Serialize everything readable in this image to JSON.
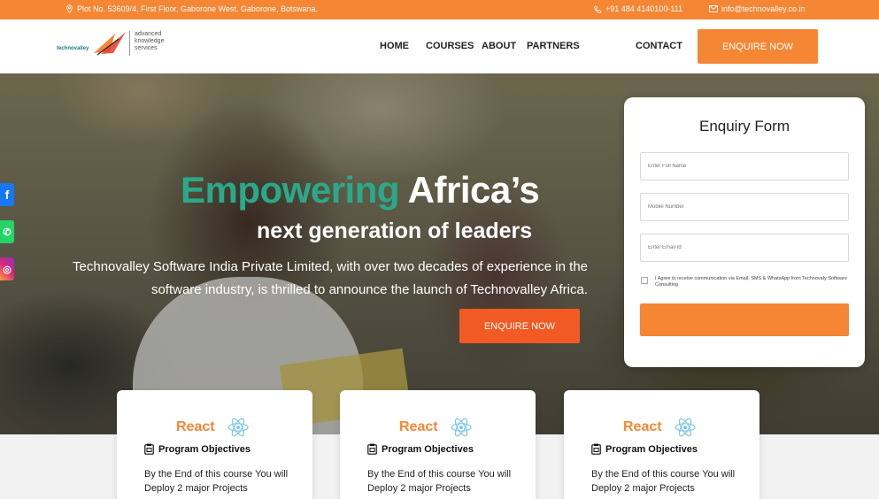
{
  "topbar": {
    "address": "Plot No. 53609/4, First Floor, Gaborone West, Gaborone, Botswana.",
    "phone": "+91 484 4140100-111",
    "email": "info@technovalley.co.in"
  },
  "header": {
    "logo_brand": "technovalley",
    "logo_tagline": "advanced knowledge services",
    "nav": [
      "HOME",
      "COURSES",
      "ABOUT",
      "PARTNERS",
      "CONTACT"
    ],
    "cta_label": "ENQUIRE NOW"
  },
  "hero": {
    "title_green": "Empowering",
    "title_white": "Africa’s",
    "subtitle": "next generation of leaders",
    "description": "Technovalley Software India Private Limited, with over two decades of experience in the software industry, is thrilled to announce the launch of Technovalley Africa.",
    "cta_label": "ENQUIRE NOW"
  },
  "social": {
    "facebook_icon": "f",
    "whatsapp_icon": "✆",
    "instagram_icon": "◎"
  },
  "form": {
    "title": "Enquiry Form",
    "name_placeholder": "Enter Full Name",
    "mobile_placeholder": "Mobile Number",
    "email_placeholder": "Enter Email Id",
    "consent": "I Agree to receive communication via Email, SMS & WhatsApp from Technovaly Software Consulting",
    "submit_label": ""
  },
  "cards": [
    {
      "title": "React",
      "objectives": "Program Objectives",
      "description": "By the End of this course You will Deploy 2 major Projects"
    },
    {
      "title": "React",
      "objectives": "Program Objectives",
      "description": "By the End of this course You will Deploy 2 major Projects"
    },
    {
      "title": "React",
      "objectives": "Program Objectives",
      "description": "By the End of this course You will Deploy 2 major Projects"
    }
  ],
  "colors": {
    "accent": "#f58634",
    "brand_green": "#2aa98a"
  }
}
